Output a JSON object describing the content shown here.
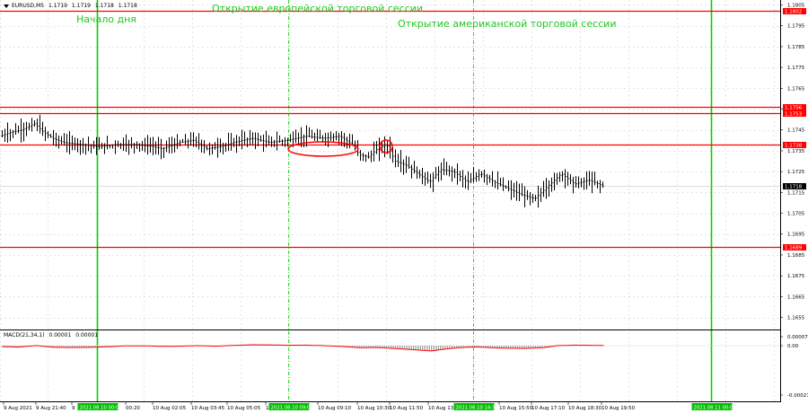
{
  "symbol": {
    "name": "EURUSD,M5",
    "open": "1.1719",
    "high": "1.1719",
    "low": "1.1718",
    "close": "1.1718"
  },
  "annotations": {
    "day_start": "Начало дня",
    "eu_session": "Открытие европейской торговой сессии",
    "us_session": "Открытие американской торговой сессии"
  },
  "macd": {
    "label": "MACD(21,34,1)",
    "value1": "0.00001",
    "value2": "0.00001"
  },
  "colors": {
    "level_line": "#ff0000",
    "session_line": "#00d000",
    "bar": "#000000",
    "grid": "#c8c8c8",
    "macd_hist": "#a0a0a0",
    "macd_signal": "#ff0000",
    "price_tag_bg": "#ff0000",
    "current_tag_bg": "#000000",
    "time_tag_bg": "#00c000"
  },
  "chart_data": {
    "type": "ohlc",
    "ylim": [
      1.16505,
      1.18065
    ],
    "price_ticks": [
      "1.1805",
      "1.1795",
      "1.1785",
      "1.1775",
      "1.1765",
      "1.1755",
      "1.1745",
      "1.1735",
      "1.1725",
      "1.1715",
      "1.1705",
      "1.1695",
      "1.1685",
      "1.1675",
      "1.1665",
      "1.1655"
    ],
    "x_labels": [
      "9 Aug 2021",
      "9 Aug 21:40",
      "9",
      "00:20",
      "10 Aug 02:05",
      "10 Aug 03:45",
      "10 Aug 05:05",
      "10 Aug",
      "10 Aug 09:10",
      "10 Aug 10:30",
      "10 Aug 11:50",
      "10 Aug 13:",
      "10 Aug 15:50",
      "10 Aug 17:10",
      "10 Aug 18:30",
      "10 Aug 19:50"
    ],
    "levels": [
      {
        "price": 1.1802,
        "label": "1.1802"
      },
      {
        "price": 1.1756,
        "label": "1.1756"
      },
      {
        "price": 1.1753,
        "label": "1.1753"
      },
      {
        "price": 1.1738,
        "label": "1.1738"
      },
      {
        "price": 1.1689,
        "label": "1.1689"
      }
    ],
    "current_price": {
      "price": 1.1718,
      "label": "1.1718"
    },
    "vertical_times": [
      {
        "label": "2021.08.10 00:00",
        "style": "solid"
      },
      {
        "label": "2021.08.10 09:00",
        "style": "dashed"
      },
      {
        "label": "2021.08.10 14:30",
        "style": "dashed"
      },
      {
        "label": "2021.08.11 00:00",
        "style": "solid"
      }
    ],
    "close_path": [
      [
        0,
        1.1742
      ],
      [
        12,
        1.1744
      ],
      [
        24,
        1.1745
      ],
      [
        38,
        1.1748
      ],
      [
        48,
        1.1744
      ],
      [
        58,
        1.1741
      ],
      [
        70,
        1.1739
      ],
      [
        90,
        1.1738
      ],
      [
        110,
        1.1737
      ],
      [
        130,
        1.1738
      ],
      [
        150,
        1.1738
      ],
      [
        170,
        1.1737
      ],
      [
        180,
        1.1736
      ],
      [
        200,
        1.1739
      ],
      [
        215,
        1.174
      ],
      [
        230,
        1.1736
      ],
      [
        245,
        1.1737
      ],
      [
        260,
        1.1739
      ],
      [
        280,
        1.1741
      ],
      [
        300,
        1.1739
      ],
      [
        320,
        1.174
      ],
      [
        340,
        1.1742
      ],
      [
        360,
        1.1741
      ],
      [
        378,
        1.1742
      ],
      [
        392,
        1.1738
      ],
      [
        400,
        1.1733
      ],
      [
        410,
        1.1732
      ],
      [
        420,
        1.1736
      ],
      [
        430,
        1.1738
      ],
      [
        440,
        1.173
      ],
      [
        452,
        1.1728
      ],
      [
        465,
        1.1724
      ],
      [
        478,
        1.172
      ],
      [
        490,
        1.1726
      ],
      [
        505,
        1.1725
      ],
      [
        520,
        1.172
      ],
      [
        535,
        1.1724
      ],
      [
        550,
        1.172
      ],
      [
        565,
        1.1717
      ],
      [
        580,
        1.1714
      ],
      [
        595,
        1.1712
      ],
      [
        610,
        1.1718
      ],
      [
        625,
        1.1724
      ],
      [
        640,
        1.1719
      ],
      [
        655,
        1.1721
      ],
      [
        672,
        1.1718
      ]
    ],
    "macd_ticks": [
      "0.00007",
      "0.00",
      "-0.00027"
    ],
    "macd_path": [
      [
        0,
        -5e-06
      ],
      [
        20,
        -8e-06
      ],
      [
        40,
        5e-07
      ],
      [
        60,
        -9e-06
      ],
      [
        80,
        -1e-05
      ],
      [
        100,
        -9e-06
      ],
      [
        120,
        -6e-06
      ],
      [
        140,
        -1e-06
      ],
      [
        160,
        -1e-06
      ],
      [
        180,
        -4e-06
      ],
      [
        200,
        -3e-06
      ],
      [
        220,
        0.0
      ],
      [
        240,
        -3e-06
      ],
      [
        260,
        2e-06
      ],
      [
        280,
        7e-06
      ],
      [
        300,
        6e-06
      ],
      [
        320,
        3e-06
      ],
      [
        340,
        4e-06
      ],
      [
        360,
        0.0
      ],
      [
        380,
        -4e-06
      ],
      [
        400,
        -1.1e-05
      ],
      [
        420,
        -1e-05
      ],
      [
        440,
        -1.6e-05
      ],
      [
        460,
        -2.2e-05
      ],
      [
        480,
        -2.9e-05
      ],
      [
        495,
        -1.9e-05
      ],
      [
        510,
        -1.1e-05
      ],
      [
        530,
        -7e-06
      ],
      [
        550,
        -1.2e-05
      ],
      [
        565,
        -1.4e-05
      ],
      [
        585,
        -1.5e-05
      ],
      [
        605,
        -1.1e-05
      ],
      [
        620,
        0.0
      ],
      [
        640,
        4e-06
      ],
      [
        655,
        3e-06
      ],
      [
        672,
        1e-06
      ]
    ]
  }
}
